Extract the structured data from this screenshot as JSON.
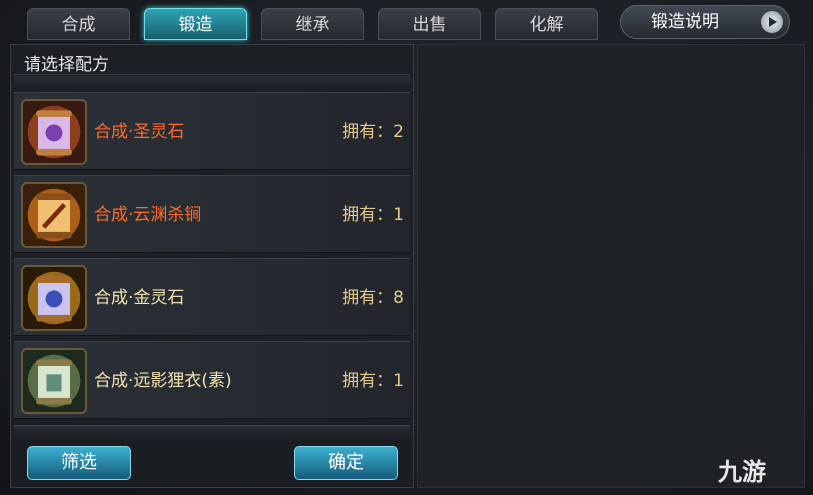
{
  "tabs": [
    {
      "label": "合成"
    },
    {
      "label": "锻造",
      "active": true
    },
    {
      "label": "继承"
    },
    {
      "label": "出售"
    },
    {
      "label": "化解"
    }
  ],
  "help_button": {
    "label": "锻造说明"
  },
  "panel": {
    "title": "请选择配方"
  },
  "recipes": [
    {
      "name": "合成·圣灵石",
      "owned": "拥有：2",
      "color": "#ff6a2a",
      "icon": "purple-scroll-icon"
    },
    {
      "name": "合成·云渊杀锏",
      "owned": "拥有：1",
      "color": "#ff6a2a",
      "icon": "gold-scroll-icon"
    },
    {
      "name": "合成·金灵石",
      "owned": "拥有：8",
      "color": "#f1e3b0",
      "icon": "blue-scroll-icon"
    },
    {
      "name": "合成·远影狸衣(素)",
      "owned": "拥有：1",
      "color": "#f1e3b0",
      "icon": "green-scroll-icon"
    }
  ],
  "buttons": {
    "filter": "筛选",
    "confirm": "确定"
  },
  "watermark": "九游",
  "colors": {
    "active_tab": "#2ea3b3",
    "button": "#3db0d1",
    "orange_name": "#ff6a2a"
  }
}
